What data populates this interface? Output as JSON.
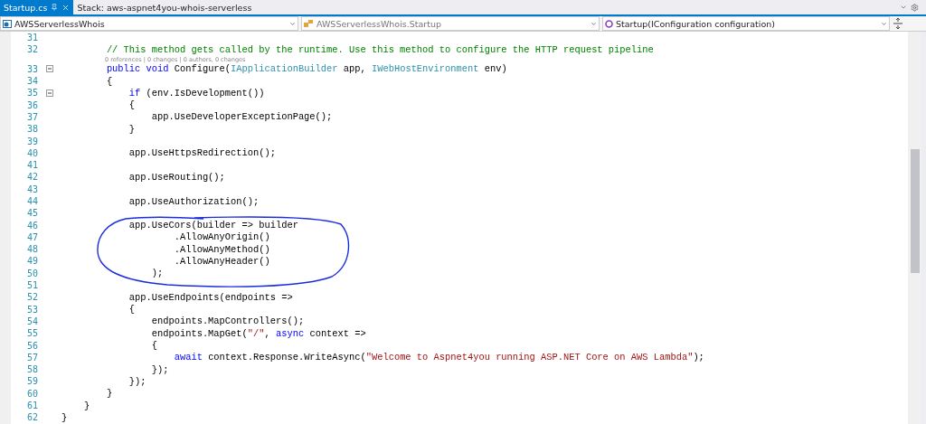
{
  "tabs": [
    {
      "label": "Startup.cs",
      "selected": true
    },
    {
      "label": "Stack: aws-aspnet4you-whois-serverless",
      "selected": false
    }
  ],
  "navigation": [
    {
      "kind": "project",
      "text": "AWSServerlessWhois"
    },
    {
      "kind": "class",
      "text": "AWSServerlessWhois.Startup"
    },
    {
      "kind": "member",
      "text": "Startup(IConfiguration configuration)"
    }
  ],
  "lines": [
    {
      "number": "31"
    },
    {
      "number": "32",
      "tokens": [
        {
          "kind": "comment",
          "text": "        // This method gets called by the runtime. Use this method to configure the HTTP request pipeline"
        }
      ]
    },
    {
      "number": "33",
      "codelens": "0 references | 0 changes | 0 authors, 0 changes",
      "folded": false,
      "tokens": [
        {
          "kind": "keyword",
          "text": "        public void"
        },
        {
          "kind": "plain",
          "text": " Configure("
        },
        {
          "kind": "type",
          "text": "IApplicationBuilder"
        },
        {
          "kind": "plain",
          "text": " app, "
        },
        {
          "kind": "type",
          "text": "IWebHostEnvironment"
        },
        {
          "kind": "plain",
          "text": " env)"
        }
      ]
    },
    {
      "number": "34",
      "tokens": [
        {
          "kind": "plain",
          "text": "        {"
        }
      ]
    },
    {
      "number": "35",
      "folded": false,
      "tokens": [
        {
          "kind": "keyword",
          "text": "            if"
        },
        {
          "kind": "plain",
          "text": " (env.IsDevelopment())"
        }
      ]
    },
    {
      "number": "36",
      "tokens": [
        {
          "kind": "plain",
          "text": "            {"
        }
      ]
    },
    {
      "number": "37",
      "tokens": [
        {
          "kind": "plain",
          "text": "                app.UseDeveloperExceptionPage();"
        }
      ]
    },
    {
      "number": "38",
      "tokens": [
        {
          "kind": "plain",
          "text": "            }"
        }
      ]
    },
    {
      "number": "39"
    },
    {
      "number": "40",
      "tokens": [
        {
          "kind": "plain",
          "text": "            app.UseHttpsRedirection();"
        }
      ]
    },
    {
      "number": "41"
    },
    {
      "number": "42",
      "tokens": [
        {
          "kind": "plain",
          "text": "            app.UseRouting();"
        }
      ]
    },
    {
      "number": "43"
    },
    {
      "number": "44",
      "tokens": [
        {
          "kind": "plain",
          "text": "            app.UseAuthorization();"
        }
      ]
    },
    {
      "number": "45"
    },
    {
      "number": "46",
      "tokens": [
        {
          "kind": "plain",
          "text": "            app.UseCors(builder => builder"
        }
      ]
    },
    {
      "number": "47",
      "tokens": [
        {
          "kind": "plain",
          "text": "                    .AllowAnyOrigin()"
        }
      ]
    },
    {
      "number": "48",
      "tokens": [
        {
          "kind": "plain",
          "text": "                    .AllowAnyMethod()"
        }
      ]
    },
    {
      "number": "49",
      "tokens": [
        {
          "kind": "plain",
          "text": "                    .AllowAnyHeader()"
        }
      ]
    },
    {
      "number": "50",
      "tokens": [
        {
          "kind": "plain",
          "text": "                );"
        }
      ]
    },
    {
      "number": "51"
    },
    {
      "number": "52",
      "tokens": [
        {
          "kind": "plain",
          "text": "            app.UseEndpoints(endpoints =>"
        }
      ]
    },
    {
      "number": "53",
      "tokens": [
        {
          "kind": "plain",
          "text": "            {"
        }
      ]
    },
    {
      "number": "54",
      "tokens": [
        {
          "kind": "plain",
          "text": "                endpoints.MapControllers();"
        }
      ]
    },
    {
      "number": "55",
      "tokens": [
        {
          "kind": "plain",
          "text": "                endpoints.MapGet("
        },
        {
          "kind": "string",
          "text": "\"/\""
        },
        {
          "kind": "plain",
          "text": ", "
        },
        {
          "kind": "keyword",
          "text": "async"
        },
        {
          "kind": "plain",
          "text": " context =>"
        }
      ]
    },
    {
      "number": "56",
      "tokens": [
        {
          "kind": "plain",
          "text": "                {"
        }
      ]
    },
    {
      "number": "57",
      "tokens": [
        {
          "kind": "keyword",
          "text": "                    await"
        },
        {
          "kind": "plain",
          "text": " context.Response.WriteAsync("
        },
        {
          "kind": "string",
          "text": "\"Welcome to Aspnet4you running ASP.NET Core on AWS Lambda\""
        },
        {
          "kind": "plain",
          "text": ");"
        }
      ]
    },
    {
      "number": "58",
      "tokens": [
        {
          "kind": "plain",
          "text": "                });"
        }
      ]
    },
    {
      "number": "59",
      "tokens": [
        {
          "kind": "plain",
          "text": "            });"
        }
      ]
    },
    {
      "number": "60",
      "tokens": [
        {
          "kind": "plain",
          "text": "        }"
        }
      ]
    },
    {
      "number": "61",
      "tokens": [
        {
          "kind": "plain",
          "text": "    }"
        }
      ]
    },
    {
      "number": "62",
      "tokens": [
        {
          "kind": "plain",
          "text": "}"
        }
      ]
    }
  ]
}
